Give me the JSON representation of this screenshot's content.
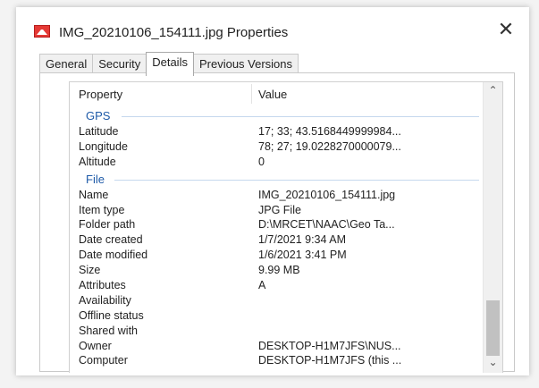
{
  "window": {
    "title": "IMG_20210106_154111.jpg Properties",
    "close_glyph": "✕"
  },
  "tabs": [
    {
      "label": "General"
    },
    {
      "label": "Security"
    },
    {
      "label": "Details"
    },
    {
      "label": "Previous Versions"
    }
  ],
  "details": {
    "header_property": "Property",
    "header_value": "Value",
    "groups": {
      "gps": {
        "label": "GPS",
        "rows": [
          {
            "property": "Latitude",
            "value": "17; 33; 43.5168449999984..."
          },
          {
            "property": "Longitude",
            "value": "78; 27; 19.0228270000079..."
          },
          {
            "property": "Altitude",
            "value": "0"
          }
        ]
      },
      "file": {
        "label": "File",
        "rows": [
          {
            "property": "Name",
            "value": "IMG_20210106_154111.jpg"
          },
          {
            "property": "Item type",
            "value": "JPG File"
          },
          {
            "property": "Folder path",
            "value": "D:\\MRCET\\NAAC\\Geo Ta..."
          },
          {
            "property": "Date created",
            "value": "1/7/2021 9:34 AM"
          },
          {
            "property": "Date modified",
            "value": "1/6/2021 3:41 PM"
          },
          {
            "property": "Size",
            "value": "9.99 MB"
          },
          {
            "property": "Attributes",
            "value": "A"
          },
          {
            "property": "Availability",
            "value": ""
          },
          {
            "property": "Offline status",
            "value": ""
          },
          {
            "property": "Shared with",
            "value": ""
          },
          {
            "property": "Owner",
            "value": "DESKTOP-H1M7JFS\\NUS..."
          },
          {
            "property": "Computer",
            "value": "DESKTOP-H1M7JFS (this ..."
          }
        ]
      }
    }
  },
  "scrollbar": {
    "up_glyph": "⌃",
    "down_glyph": "⌄"
  },
  "colors": {
    "group_label": "#1e5aa8",
    "group_line": "#c6d8ee",
    "file_icon": "#e53935"
  },
  "icons": {
    "title": "jpg-file-icon"
  }
}
